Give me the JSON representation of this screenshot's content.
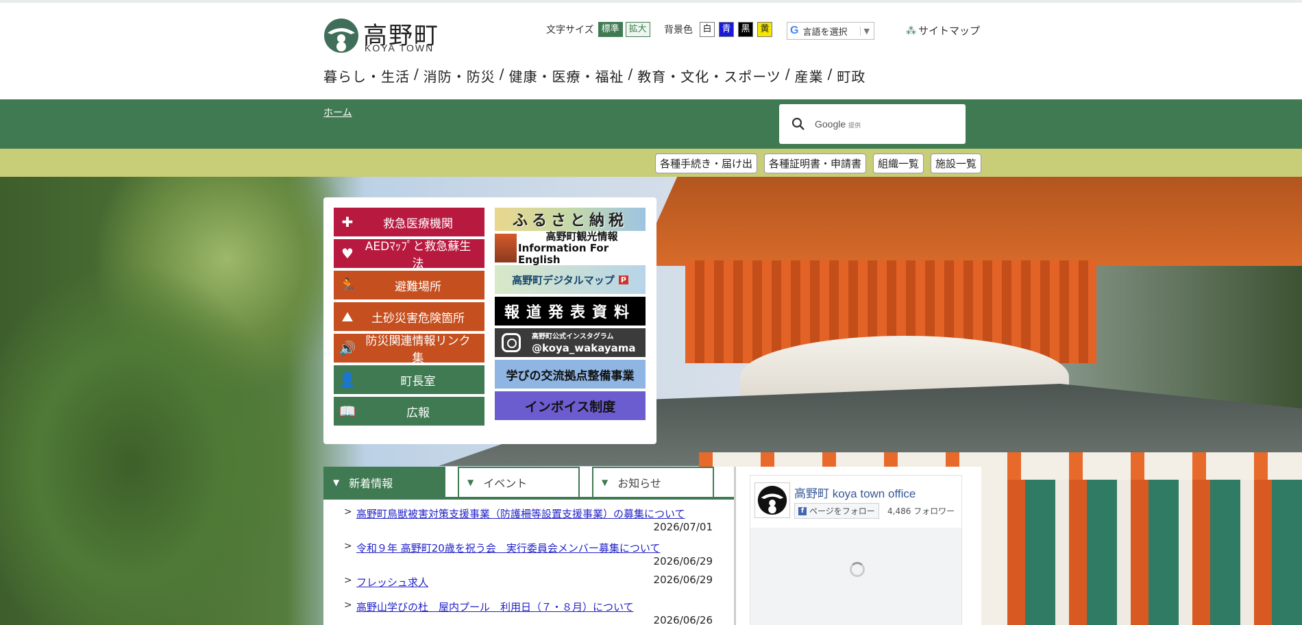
{
  "logo": {
    "name_jp": "高野町",
    "name_en": "KOYA TOWN"
  },
  "header": {
    "text_size_label": "文字サイズ",
    "text_size_standard": "標準",
    "text_size_large": "拡大",
    "bg_color_label": "背景色",
    "bg_white": "白",
    "bg_blue": "青",
    "bg_black": "黒",
    "bg_yellow": "黄",
    "language_select": "言語を選択",
    "sitemap": "サイトマップ"
  },
  "global_nav": [
    "暮らし・生活",
    "消防・防災",
    "健康・医療・福祉",
    "教育・文化・スポーツ",
    "産業",
    "町政"
  ],
  "nav_separator": "/",
  "breadcrumb": {
    "home": "ホーム"
  },
  "search": {
    "placeholder": "Google",
    "provided": "提供"
  },
  "quick_links": [
    "各種手続き・届け出",
    "各種証明書・申請書",
    "組織一覧",
    "施設一覧"
  ],
  "quick_buttons": [
    {
      "label": "救急医療機関",
      "icon": "cross-icon"
    },
    {
      "label": "AEDﾏｯﾌﾟと救急蘇生法",
      "icon": "heart-icon"
    },
    {
      "label": "避難場所",
      "icon": "evacuation-icon"
    },
    {
      "label": "土砂災害危険箇所",
      "icon": "landslide-icon"
    },
    {
      "label": "防災関連情報リンク集",
      "icon": "speaker-icon"
    },
    {
      "label": "町長室",
      "icon": "person-icon"
    },
    {
      "label": "広報",
      "icon": "book-icon"
    }
  ],
  "banners": {
    "furusato": "ふるさと納税",
    "tourism_jp": "高野町観光情報",
    "tourism_en": "Information For English",
    "digital_map": "高野町デジタルマップ",
    "digital_map_badge": "P",
    "press": "報道発表資料",
    "instagram_label": "高野町公式インスタグラム",
    "instagram_handle": "@koya_wakayama",
    "learning": "学びの交流拠点整備事業",
    "invoice": "インボイス制度"
  },
  "news_tabs": [
    "新着情報",
    "イベント",
    "お知らせ"
  ],
  "news_items": [
    {
      "title": "高野町鳥獣被害対策支援事業（防護柵等設置支援事業）の募集について",
      "date": "2026/07/01"
    },
    {
      "title": "令和９年 高野町20歳を祝う会　実行委員会メンバー募集について",
      "date": "2026/06/29"
    },
    {
      "title": "フレッシュ求人",
      "date": "2026/06/29"
    },
    {
      "title": "高野山学びの杜　屋内プール　利用日（７・８月）について",
      "date": "2026/06/26"
    }
  ],
  "facebook": {
    "page_name": "高野町 koya town office",
    "follow_label": "ページをフォロー",
    "followers": "4,486 フォロワー"
  },
  "colors": {
    "brand_green": "#3f7a52",
    "olive_bar": "#c8cd78",
    "emergency_red": "#b8193f",
    "disaster_orange": "#c54f1f",
    "invoice_purple": "#6b5dcf"
  }
}
